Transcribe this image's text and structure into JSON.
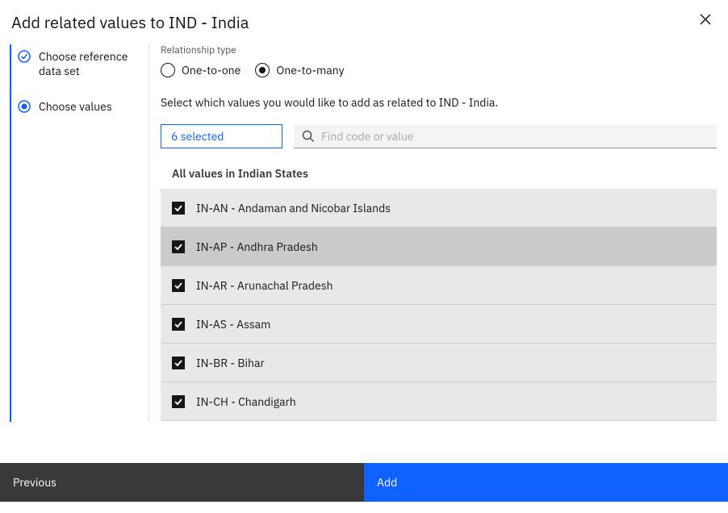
{
  "header": {
    "title": "Add related values to IND - India"
  },
  "sidebar": {
    "steps": [
      {
        "label": "Choose reference data set",
        "state": "complete"
      },
      {
        "label": "Choose values",
        "state": "current"
      }
    ]
  },
  "main": {
    "relationship_type_label": "Relationship type",
    "radio_options": {
      "one_to_one": "One-to-one",
      "one_to_many": "One-to-many"
    },
    "radio_selected": "one_to_many",
    "instruction": "Select which values you would like to add as related to IND - India.",
    "selected_count_label": "6 selected",
    "search_placeholder": "Find code or value",
    "list_heading": "All values in Indian States",
    "rows": [
      {
        "label": "IN-AN - Andaman and Nicobar Islands",
        "checked": true
      },
      {
        "label": "IN-AP - Andhra Pradesh",
        "checked": true,
        "hover": true
      },
      {
        "label": "IN-AR - Arunachal Pradesh",
        "checked": true
      },
      {
        "label": "IN-AS - Assam",
        "checked": true
      },
      {
        "label": "IN-BR - Bihar",
        "checked": true
      },
      {
        "label": "IN-CH - Chandigarh",
        "checked": true
      }
    ]
  },
  "footer": {
    "previous": "Previous",
    "add": "Add"
  },
  "colors": {
    "primary": "#0f62fe",
    "secondary": "#393939"
  }
}
